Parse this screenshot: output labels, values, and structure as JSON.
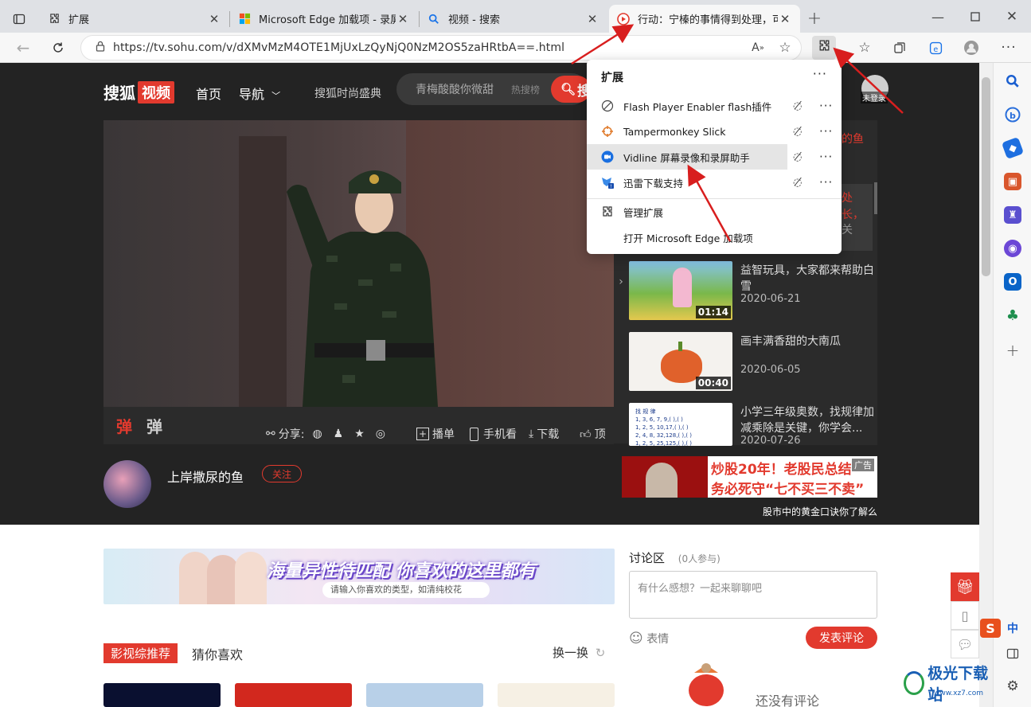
{
  "tabs": [
    {
      "title": "扩展",
      "icon": "puzzle-icon"
    },
    {
      "title": "Microsoft Edge 加载项 - 录屏",
      "icon": "microsoft-logo-icon"
    },
    {
      "title": "视频 - 搜索",
      "icon": "search-icon"
    },
    {
      "title": "行动：宁榛的事情得到处理，可以",
      "icon": "sohu-video-icon",
      "active": true
    }
  ],
  "address_bar": {
    "url": "https://tv.sohu.com/v/dXMvMzM4OTE1MjUxLzQyNjQ0NzM2OS5zaHRtbA==.html"
  },
  "site": {
    "logo_text": "搜狐",
    "logo_box": "视频",
    "nav": [
      "首页",
      "导航",
      "搜狐时尚盛典"
    ],
    "search_placeholder": "青梅酸酸你微甜",
    "search_hot": "热搜榜",
    "search_button": "搜",
    "login_label": "未登录"
  },
  "video_controls": {
    "danmu_on": "弹",
    "danmu_settings": "弹",
    "share": "分享:",
    "playlist": "播单",
    "mobile": "手机看",
    "download": "下载",
    "like": "顶"
  },
  "playlist": {
    "partial_top": [
      {
        "line": "的鱼"
      }
    ],
    "partial_mid": [
      "处",
      "长，",
      "关"
    ],
    "items": [
      {
        "title": "益智玩具，大家都来帮助白雪",
        "date": "2020-06-21",
        "duration": "01:14"
      },
      {
        "title": "画丰满香甜的大南瓜",
        "date": "2020-06-05",
        "duration": "00:40"
      },
      {
        "title": "小学三年级奥数，找规律加减乘除是关键，你学会...",
        "date": "2020-07-26",
        "duration": ""
      }
    ]
  },
  "uploader": {
    "name": "上岸撒尿的鱼",
    "follow": "关注"
  },
  "ad": {
    "line1": "炒股20年！老股民总结",
    "line2": "务必死守“七不买三不卖”",
    "tag": "广告",
    "caption": "股市中的黄金口诀你了解么"
  },
  "banner": {
    "title": "海量异性待匹配 你喜欢的这里都有",
    "search_hint": "请输入你喜欢的类型，如清纯校花"
  },
  "recommend": {
    "tab_active": "影视综推荐",
    "tab_other": "猜你喜欢",
    "refresh": "换一换"
  },
  "discussion": {
    "title": "讨论区",
    "count": "(0人参与)",
    "placeholder": "有什么感想？一起来聊聊吧",
    "emoji": "表情",
    "post_button": "发表评论",
    "empty": "还没有评论"
  },
  "extensions_popup": {
    "title": "扩展",
    "items": [
      {
        "name": "Flash Player Enabler flash插件",
        "icon": "flash-disabled-icon"
      },
      {
        "name": "Tampermonkey Slick",
        "icon": "tampermonkey-icon"
      },
      {
        "name": "Vidline 屏幕录像和录屏助手",
        "icon": "vidline-icon",
        "highlighted": true
      },
      {
        "name": "迅雷下载支持",
        "icon": "thunder-icon"
      }
    ],
    "manage": "管理扩展",
    "open_addons": "打开 Microsoft Edge 加载项"
  },
  "watermark": {
    "text": "极光下载站",
    "sub": "www.xz7.com"
  },
  "ime": {
    "label": "中"
  },
  "colors": {
    "sohu_red": "#e23a2e",
    "page_dark": "#232323",
    "arrow_red": "#d81e1e"
  }
}
